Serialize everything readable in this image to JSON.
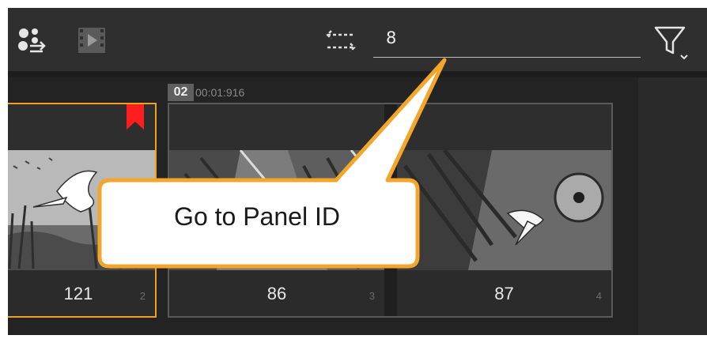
{
  "toolbar": {
    "search": {
      "value": "8"
    }
  },
  "scene": {
    "badge": "02",
    "time": "00:01:916"
  },
  "panels": [
    {
      "number": "121",
      "index": "2"
    },
    {
      "number": "86",
      "index": "3"
    },
    {
      "number": "87",
      "index": "4"
    }
  ],
  "callout": {
    "text": "Go to Panel ID"
  },
  "colors": {
    "selection": "#f0a020",
    "bookmark": "#ff1e1e",
    "callout_border": "#f4a62a"
  }
}
